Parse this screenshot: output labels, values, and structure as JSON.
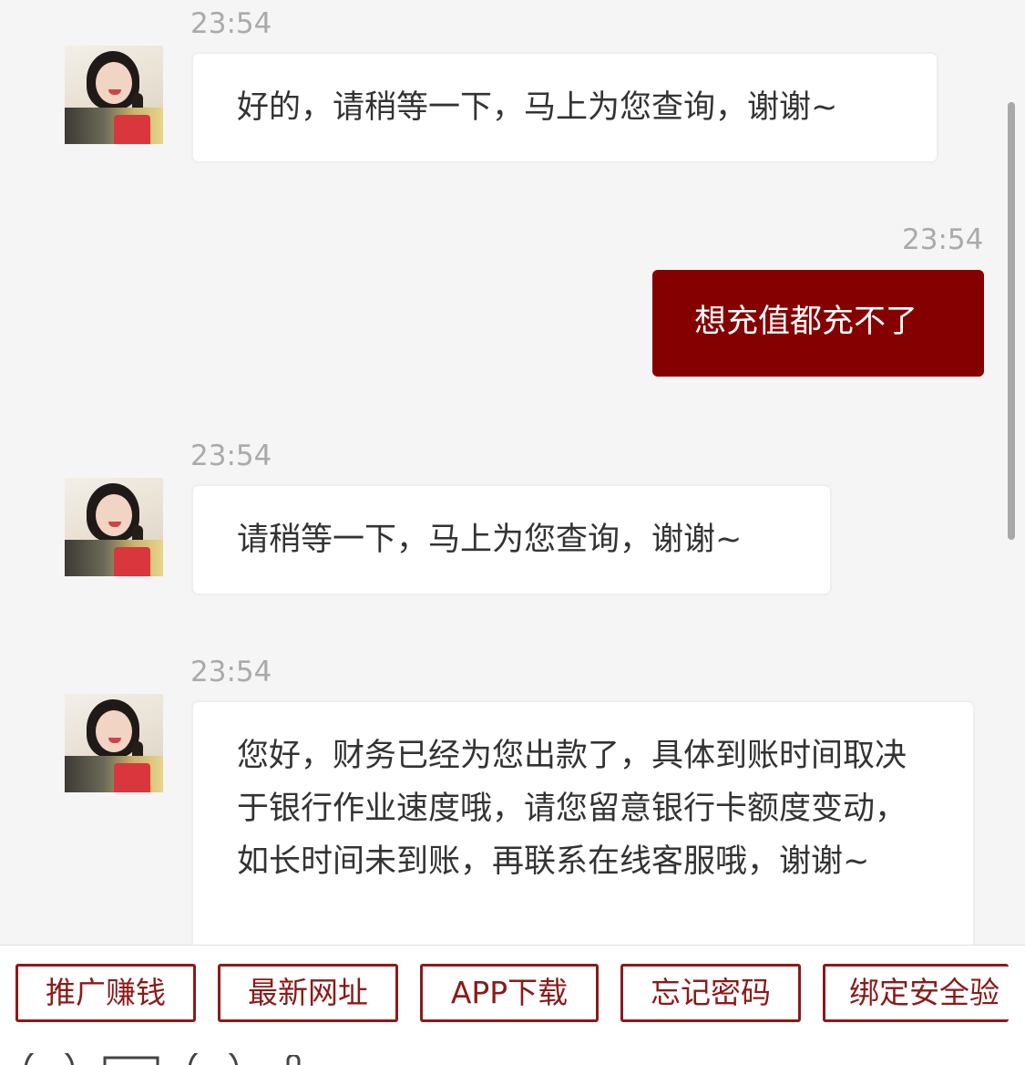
{
  "messages": [
    {
      "time": "23:54",
      "side": "left",
      "text": "好的，请稍等一下，马上为您查询，谢谢~"
    },
    {
      "time": "23:54",
      "side": "right",
      "text": "想充值都充不了"
    },
    {
      "time": "23:54",
      "side": "left",
      "text": "请稍等一下，马上为您查询，谢谢~"
    },
    {
      "time": "23:54",
      "side": "left",
      "text": "您好，财务已经为您出款了，具体到账时间取决于银行作业速度哦，请您留意银行卡额度变动，如长时间未到账，再联系在线客服哦，谢谢~"
    }
  ],
  "quick_buttons": [
    "推广赚钱",
    "最新网址",
    "APP下载",
    "忘记密码",
    "绑定安全验"
  ],
  "toolbar_icons": [
    "emoji-icon",
    "image-icon",
    "emoji-icon",
    "attachment-icon"
  ],
  "colors": {
    "outgoing_bubble": "#850000",
    "button_border": "#8b1a1a",
    "timestamp": "#aaaaaa"
  }
}
